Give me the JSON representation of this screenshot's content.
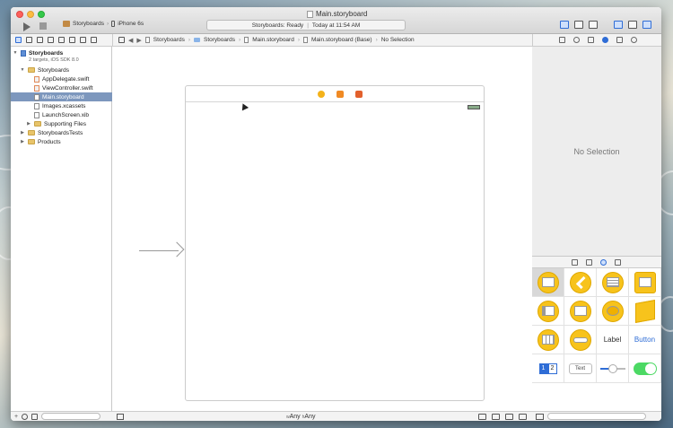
{
  "window": {
    "title": "Main.storyboard"
  },
  "toolbar": {
    "scheme_target": "Storyboards",
    "scheme_separator": "›",
    "scheme_device": "iPhone 6s",
    "activity_status": "Storyboards: Ready",
    "activity_separator": "|",
    "activity_time": "Today at 11:54 AM"
  },
  "jump_bar": {
    "back": "◀",
    "forward": "▶",
    "chevron": "›",
    "items": [
      "Storyboards",
      "Storyboards",
      "Main.storyboard",
      "Main.storyboard (Base)",
      "No Selection"
    ]
  },
  "navigator": {
    "project_name": "Storyboards",
    "project_subtitle": "2 targets, iOS SDK 8.0",
    "rows": [
      {
        "label": "Storyboards",
        "kind": "folder",
        "disclose": "▼"
      },
      {
        "label": "AppDelegate.swift",
        "kind": "swift"
      },
      {
        "label": "ViewController.swift",
        "kind": "swift"
      },
      {
        "label": "Main.storyboard",
        "kind": "storyboard",
        "selected": true
      },
      {
        "label": "Images.xcassets",
        "kind": "assets"
      },
      {
        "label": "LaunchScreen.xib",
        "kind": "xib"
      },
      {
        "label": "Supporting Files",
        "kind": "folder",
        "disclose": "▶"
      },
      {
        "label": "StoryboardsTests",
        "kind": "folder",
        "disclose": "▶"
      },
      {
        "label": "Products",
        "kind": "folder",
        "disclose": "▶"
      }
    ],
    "footer_add": "+"
  },
  "canvas": {
    "size_class_w": "w",
    "size_class_w_value": "Any",
    "size_class_h": "h",
    "size_class_h_value": "Any"
  },
  "inspector": {
    "empty_text": "No Selection"
  },
  "library": {
    "label_item": "Label",
    "button_item": "Button",
    "segment_1": "1",
    "segment_2": "2",
    "text_field_item": "Text",
    "slider_value": 0.5
  },
  "colors": {
    "selection": "#7d97bd",
    "accent": "#2f6dd6",
    "object_yellow": "#f7c31c",
    "switch_on": "#4cd964"
  }
}
